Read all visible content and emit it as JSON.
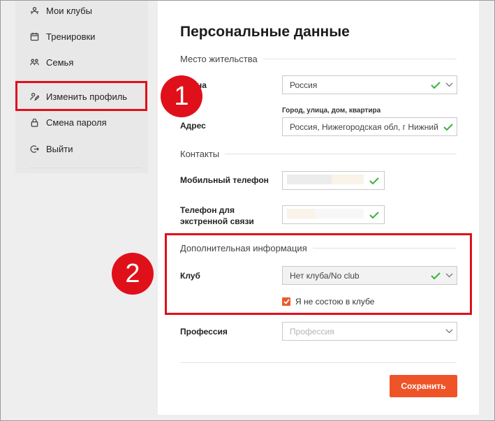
{
  "sidebar": {
    "items": [
      {
        "label": "Мои клубы",
        "icon": "clubs-icon"
      },
      {
        "label": "Тренировки",
        "icon": "calendar-icon"
      },
      {
        "label": "Семья",
        "icon": "family-icon"
      },
      {
        "label": "Изменить профиль",
        "icon": "edit-profile-icon"
      },
      {
        "label": "Смена пароля",
        "icon": "lock-icon"
      },
      {
        "label": "Выйти",
        "icon": "logout-icon"
      }
    ]
  },
  "callouts": {
    "one": "1",
    "two": "2"
  },
  "form": {
    "title": "Персональные данные",
    "sections": {
      "residence": "Место жительства",
      "contacts": "Контакты",
      "additional": "Дополнительная информация"
    },
    "country": {
      "label": "Страна",
      "label_visible": "на",
      "value": "Россия"
    },
    "address": {
      "label": "Адрес",
      "hint": "Город, улица, дом, квартира",
      "value": "Россия, Нижегородская обл, г Нижний"
    },
    "mobile": {
      "label": "Мобильный телефон"
    },
    "emergency": {
      "label_line1": "Телефон для",
      "label_line2": "экстренной связи"
    },
    "club": {
      "label": "Клуб",
      "value": "Нет клуба/No club"
    },
    "no_club_checkbox": {
      "label": "Я не состою в клубе",
      "checked": true
    },
    "profession": {
      "label": "Профессия",
      "placeholder": "Профессия"
    },
    "save_label": "Сохранить"
  },
  "colors": {
    "accent": "#ee5428",
    "callout": "#e0101a",
    "valid": "#3ab23a"
  }
}
